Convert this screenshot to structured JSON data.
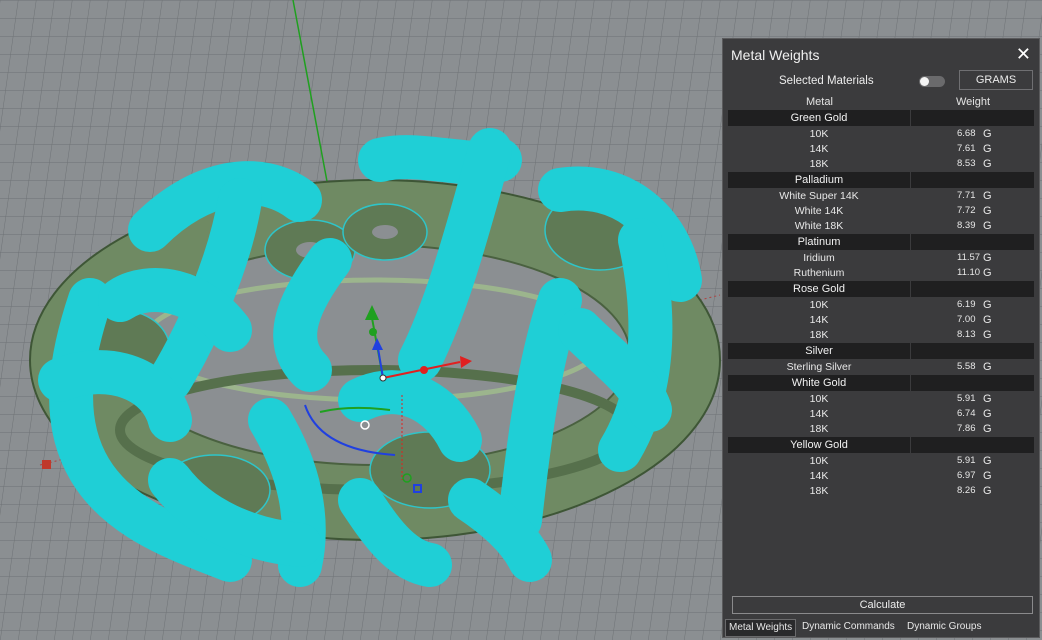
{
  "panel": {
    "title": "Metal Weights",
    "close_glyph": "✕",
    "selected_label": "Selected Materials",
    "selected_on": false,
    "units_button": "GRAMS",
    "col_metal": "Metal",
    "col_weight": "Weight",
    "groups": [
      {
        "name": "Green Gold",
        "rows": [
          {
            "metal": "10K",
            "weight": "6.68",
            "unit": "G"
          },
          {
            "metal": "14K",
            "weight": "7.61",
            "unit": "G"
          },
          {
            "metal": "18K",
            "weight": "8.53",
            "unit": "G"
          }
        ]
      },
      {
        "name": "Palladium",
        "rows": [
          {
            "metal": "White Super 14K",
            "weight": "7.71",
            "unit": "G"
          },
          {
            "metal": "White 14K",
            "weight": "7.72",
            "unit": "G"
          },
          {
            "metal": "White 18K",
            "weight": "8.39",
            "unit": "G"
          }
        ]
      },
      {
        "name": "Platinum",
        "rows": [
          {
            "metal": "Iridium",
            "weight": "11.57",
            "unit": "G"
          },
          {
            "metal": "Ruthenium",
            "weight": "11.10",
            "unit": "G"
          }
        ]
      },
      {
        "name": "Rose Gold",
        "rows": [
          {
            "metal": "10K",
            "weight": "6.19",
            "unit": "G"
          },
          {
            "metal": "14K",
            "weight": "7.00",
            "unit": "G"
          },
          {
            "metal": "18K",
            "weight": "8.13",
            "unit": "G"
          }
        ]
      },
      {
        "name": "Silver",
        "rows": [
          {
            "metal": "Sterling Silver",
            "weight": "5.58",
            "unit": "G"
          }
        ]
      },
      {
        "name": "White Gold",
        "rows": [
          {
            "metal": "10K",
            "weight": "5.91",
            "unit": "G"
          },
          {
            "metal": "14K",
            "weight": "6.74",
            "unit": "G"
          },
          {
            "metal": "18K",
            "weight": "7.86",
            "unit": "G"
          }
        ]
      },
      {
        "name": "Yellow Gold",
        "rows": [
          {
            "metal": "10K",
            "weight": "5.91",
            "unit": "G"
          },
          {
            "metal": "14K",
            "weight": "6.97",
            "unit": "G"
          },
          {
            "metal": "18K",
            "weight": "8.26",
            "unit": "G"
          }
        ]
      }
    ],
    "calculate_label": "Calculate",
    "tabs": [
      "Metal Weights",
      "Dynamic Commands",
      "Dynamic Groups"
    ],
    "active_tab": 0
  },
  "colors": {
    "viewport_bg": "#8b8f92",
    "grid_line": "#6e7275",
    "ring_green": "#6f8a63",
    "highlight_cyan": "#1fcfd6",
    "axis_x": "#e02020",
    "axis_y": "#1fa01f",
    "axis_z": "#2040e0",
    "panel_bg": "#3b3b3d"
  }
}
